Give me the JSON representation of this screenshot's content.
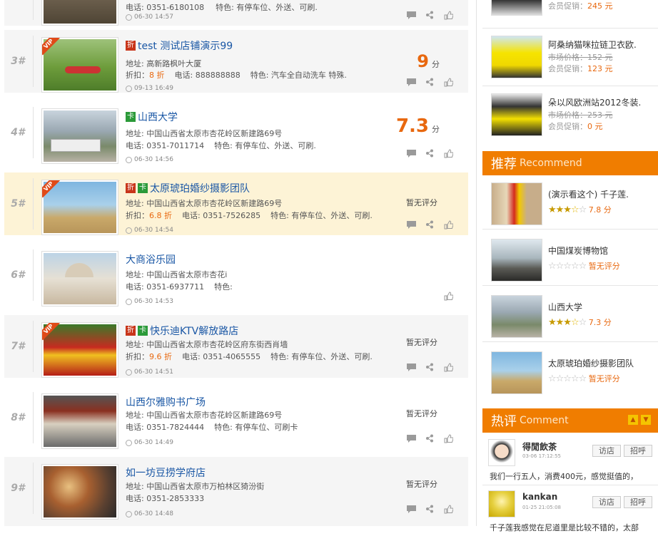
{
  "listing": {
    "top_row": {
      "phone": "电话: 0351-6180108",
      "features": "特色: 有停车位、外送、可刷.",
      "time": "06-30 14:57"
    },
    "rows": [
      {
        "rank": "3#",
        "vip": true,
        "tags": [
          "折"
        ],
        "name": "test 测试店铺演示99",
        "address": "地址: 高新路枫叶大厦",
        "discount_label": "折扣：",
        "discount": "8 折",
        "phone": "电话: 888888888",
        "features": "特色: 汽车全自动洗车 特殊.",
        "time": "09-13 16:49",
        "score": "9",
        "score_unit": "分"
      },
      {
        "rank": "4#",
        "vip": false,
        "tags": [
          "卡"
        ],
        "name": "山西大学",
        "address": "地址: 中国山西省太原市杏花岭区新建路69号",
        "phone": "电话: 0351-7011714",
        "features": "特色: 有停车位、外送、可刷.",
        "time": "06-30 14:56",
        "score": "7.3",
        "score_unit": "分"
      },
      {
        "rank": "5#",
        "vip": true,
        "tags": [
          "折",
          "卡"
        ],
        "name": "太原琥珀婚纱摄影团队",
        "address": "地址: 中国山西省太原市杏花岭区新建路69号",
        "discount_label": "折扣：",
        "discount": "6.8 折",
        "phone": "电话: 0351-7526285",
        "features": "特色: 有停车位、外送、可刷.",
        "time": "06-30 14:54",
        "noscore": "暂无评分"
      },
      {
        "rank": "6#",
        "vip": false,
        "tags": [],
        "name": "大商浴乐园",
        "address": "地址: 中国山西省太原市杏花i",
        "phone": "电话: 0351-6937711",
        "features": "特色:",
        "time": "06-30 14:53"
      },
      {
        "rank": "7#",
        "vip": true,
        "tags": [
          "折",
          "卡"
        ],
        "name": "快乐迪KTV解放路店",
        "address": "地址: 中国山西省太原市杏花岭区府东街西肖墙",
        "discount_label": "折扣：",
        "discount": "9.6 折",
        "phone": "电话: 0351-4065555",
        "features": "特色: 有停车位、外送、可刷.",
        "time": "06-30 14:51",
        "noscore": "暂无评分"
      },
      {
        "rank": "8#",
        "vip": false,
        "tags": [],
        "name": "山西尔雅购书广场",
        "address": "地址: 中国山西省太原市杏花岭区新建路69号",
        "phone": "电话: 0351-7824444",
        "features": "特色: 有停车位、可刷卡",
        "time": "06-30 14:49",
        "noscore": "暂无评分"
      },
      {
        "rank": "9#",
        "vip": false,
        "tags": [],
        "name": "如一坊豆捞学府店",
        "address": "地址: 中国山西省太原市万柏林区猗汾街",
        "phone": "电话: 0351-2853333",
        "time": "06-30 14:48",
        "noscore": "暂无评分"
      }
    ]
  },
  "sidebar": {
    "products": [
      {
        "name": "",
        "old": "",
        "promo_label": "会员促销：",
        "promo": "245 元"
      },
      {
        "name": "阿桑纳猫咪拉链卫衣欧.",
        "old": "市场价格：152 元",
        "promo_label": "会员促销：",
        "promo": "123 元"
      },
      {
        "name": "朵以风欧洲站2012冬装.",
        "old": "市场价格：253 元",
        "promo_label": "会员促销：",
        "promo": "0 元"
      }
    ],
    "recommend": {
      "title": "推荐",
      "title_en": "Recommend",
      "items": [
        {
          "name": "(演示看这个) 千子莲.",
          "stars": 3.5,
          "score": "7.8 分"
        },
        {
          "name": "中国煤炭博物馆",
          "stars": 0,
          "score": "暂无评分"
        },
        {
          "name": "山西大学",
          "stars": 3.5,
          "score": "7.3 分"
        },
        {
          "name": "太原琥珀婚纱摄影团队",
          "stars": 0,
          "score": "暂无评分"
        }
      ]
    },
    "comments": {
      "title": "热评",
      "title_en": "Comment",
      "items": [
        {
          "user": "得閒飲茶",
          "date": "03-06 17:12:55",
          "btn1": "访店",
          "btn2": "招呼",
          "text": "我们一行五人，消费400元，感觉挺值的，"
        },
        {
          "user": "kankan",
          "date": "01-25 21:05:08",
          "btn1": "访店",
          "btn2": "招呼",
          "text": "千子莲我感觉在尼道里是比较不错的，太部"
        }
      ]
    }
  },
  "colors": {
    "accent": "#f07d00",
    "link": "#1a57a5",
    "score": "#e8680f",
    "highlight_row": "#fdf3d6"
  }
}
